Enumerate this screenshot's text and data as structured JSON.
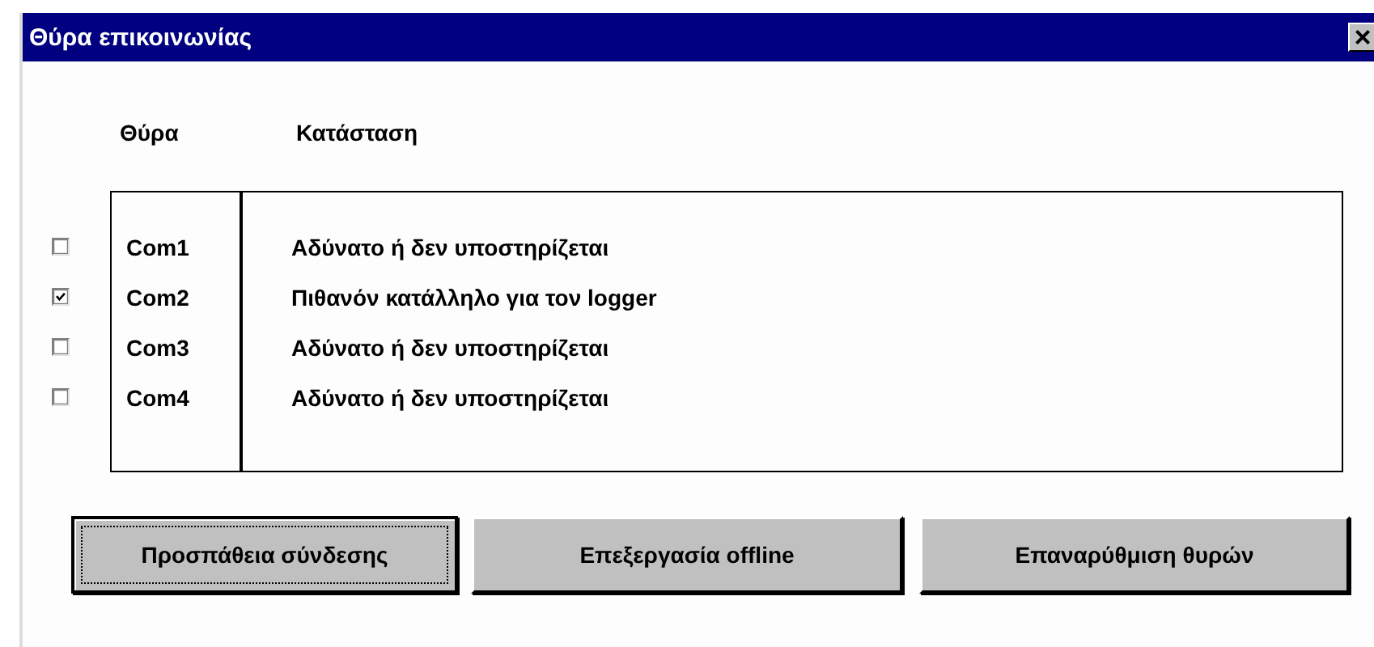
{
  "window": {
    "title": "Θύρα επικοινωνίας",
    "close": "×"
  },
  "columns": [
    "Θύρα",
    "Κατάσταση"
  ],
  "ports": [
    {
      "name": "Com1",
      "status": "Αδύνατο ή δεν υποστηρίζεται",
      "checked": false
    },
    {
      "name": "Com2",
      "status": "Πιθανόν κατάλληλο για τον logger",
      "checked": true
    },
    {
      "name": "Com3",
      "status": "Αδύνατο ή δεν υποστηρίζεται",
      "checked": false
    },
    {
      "name": "Com4",
      "status": "Αδύνατο ή δεν υποστηρίζεται",
      "checked": false
    }
  ],
  "buttons": [
    {
      "label": "Προσπάθεια σύνδεσης",
      "focused": true
    },
    {
      "label": "Επεξεργασία offline",
      "focused": false
    },
    {
      "label": "Επαναρύθμιση θυρών",
      "focused": false
    }
  ]
}
